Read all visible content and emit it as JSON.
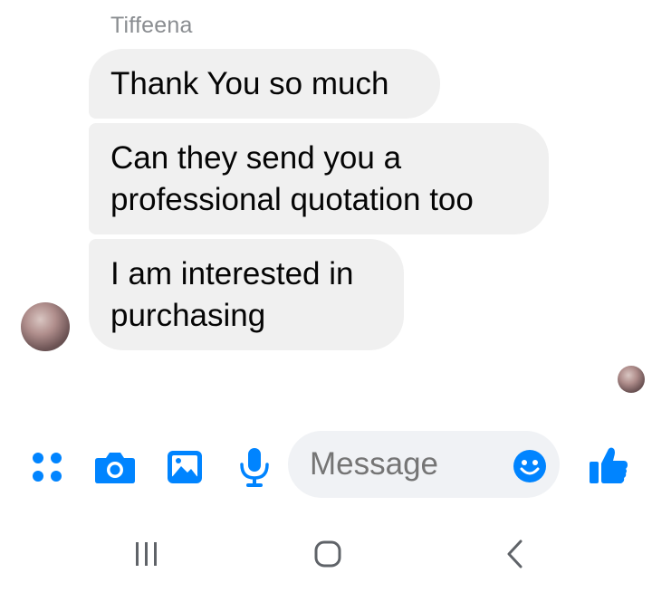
{
  "conversation": {
    "sender_name": "Tiffeena",
    "messages": [
      {
        "text": "Thank You so much"
      },
      {
        "text": "Can they send you a\nprofessional quotation too"
      },
      {
        "text": "I am interested in\npurchasing"
      }
    ]
  },
  "composer": {
    "placeholder": "Message",
    "icons": [
      "menu-dots-icon",
      "camera-icon",
      "image-icon",
      "microphone-icon",
      "emoji-icon",
      "thumbs-up-icon"
    ],
    "accent_color": "#0084ff"
  },
  "system_nav": {
    "icons": [
      "recent-apps-icon",
      "home-icon",
      "back-icon"
    ]
  }
}
